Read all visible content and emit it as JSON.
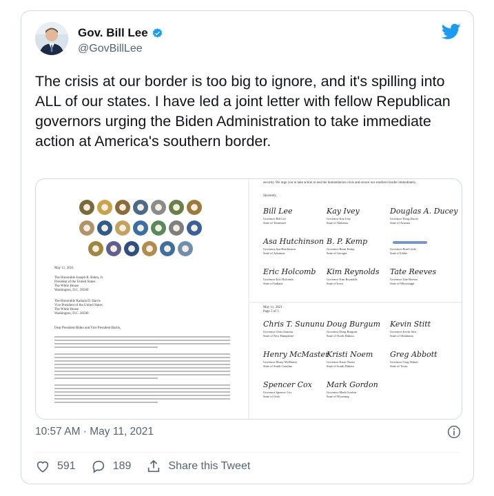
{
  "author": {
    "name": "Gov. Bill Lee",
    "handle": "@GovBillLee"
  },
  "tweet": {
    "text": "The crisis at our border is too big to ignore, and it's spilling into ALL of our states. I have led a joint letter with fellow Republican governors urging the Biden Administration to take immediate action at America's southern border."
  },
  "letter": {
    "date": "May 11, 2021",
    "addressee1": [
      "The Honorable Joseph R. Biden, Jr.",
      "President of the United States",
      "The White House",
      "Washington, D.C. 20500"
    ],
    "addressee2": [
      "The Honorable Kamala D. Harris",
      "Vice President of the United States",
      "The White House",
      "Washington, D.C. 20500"
    ],
    "salutation": "Dear President Biden and Vice President Harris,",
    "page2_intro": "security.  We urge you to take action to end the humanitarian crisis and secure our southern border immediately.",
    "sincerely": "Sincerely,",
    "page3_date": "May 11, 2021",
    "page3_label": "Page 3 of 3",
    "signers_p2": [
      {
        "sig": "Bill Lee",
        "title": "Governor Bill Lee",
        "state": "State of Tennessee"
      },
      {
        "sig": "Kay Ivey",
        "title": "Governor Kay Ivey",
        "state": "State of Alabama"
      },
      {
        "sig": "Douglas A. Ducey",
        "title": "Governor Doug Ducey",
        "state": "State of Arizona"
      },
      {
        "sig": "Asa Hutchinson",
        "title": "Governor Asa Hutchinson",
        "state": "State of Arkansas"
      },
      {
        "sig": "B. P. Kemp",
        "title": "Governor Brian Kemp",
        "state": "State of Georgia"
      },
      {
        "sig": "",
        "title": "Governor Brad Little",
        "state": "State of Idaho"
      },
      {
        "sig": "Eric Holcomb",
        "title": "Governor Eric Holcomb",
        "state": "State of Indiana"
      },
      {
        "sig": "Kim Reynolds",
        "title": "Governor Kim Reynolds",
        "state": "State of Iowa"
      },
      {
        "sig": "Tate Reeves",
        "title": "Governor Tate Reeves",
        "state": "State of Mississippi"
      }
    ],
    "signers_p3": [
      {
        "sig": "Chris T. Sununu",
        "title": "Governor Chris Sununu",
        "state": "State of New Hampshire"
      },
      {
        "sig": "Doug Burgum",
        "title": "Governor Doug Burgum",
        "state": "State of North Dakota"
      },
      {
        "sig": "Kevin Stitt",
        "title": "Governor Kevin Stitt",
        "state": "State of Oklahoma"
      },
      {
        "sig": "Henry McMaster",
        "title": "Governor Henry McMaster",
        "state": "State of South Carolina"
      },
      {
        "sig": "Kristi Noem",
        "title": "Governor Kristi Noem",
        "state": "State of South Dakota"
      },
      {
        "sig": "Greg Abbott",
        "title": "Governor Greg Abbott",
        "state": "State of Texas"
      },
      {
        "sig": "Spencer Cox",
        "title": "Governor Spencer Cox",
        "state": "State of Utah"
      },
      {
        "sig": "Mark Gordon",
        "title": "Governor Mark Gordon",
        "state": "State of Wyoming"
      }
    ],
    "seal_colors": [
      "#7a6a3a",
      "#c9a44a",
      "#8a6d3b",
      "#4c6a8a",
      "#8c8c8c",
      "#6b7f4a",
      "#9a7b3a",
      "#b3926a",
      "#2f5a8a",
      "#c2a25e",
      "#3b6ea5",
      "#5a8a5a",
      "#7f7f7f",
      "#3a5f9a",
      "#a0863f",
      "#5f5f8f",
      "#2e4f7f",
      "#b08d4f",
      "#3f6f9f",
      "#6f8faf"
    ]
  },
  "timestamp": "10:57 AM · May 11, 2021",
  "actions": {
    "likes": "591",
    "replies": "189",
    "share": "Share this Tweet"
  },
  "colors": {
    "accent": "#1d9bf0",
    "muted": "#536471"
  },
  "icons": [
    "verified-badge-icon",
    "twitter-bird-icon",
    "info-icon",
    "heart-icon",
    "reply-icon",
    "share-icon"
  ]
}
